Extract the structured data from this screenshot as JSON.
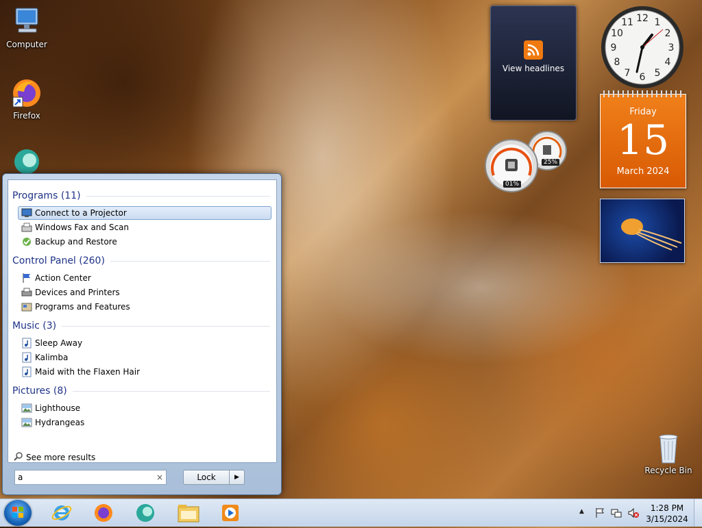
{
  "desktop": {
    "icons": [
      {
        "label": "Computer"
      },
      {
        "label": "Firefox"
      },
      {
        "label": ""
      },
      {
        "label": "Recycle Bin"
      }
    ]
  },
  "gadgets": {
    "feed_label": "View headlines",
    "calendar": {
      "weekday": "Friday",
      "day": "15",
      "month_year": "March 2024"
    },
    "cpu": {
      "cpu_percent": "01%",
      "memory_percent": "25%"
    }
  },
  "start_menu": {
    "groups": [
      {
        "title": "Programs (11)",
        "items": [
          "Connect to a Projector",
          "Windows Fax and Scan",
          "Backup and Restore"
        ]
      },
      {
        "title": "Control Panel (260)",
        "items": [
          "Action Center",
          "Devices and Printers",
          "Programs and Features"
        ]
      },
      {
        "title": "Music (3)",
        "items": [
          "Sleep Away",
          "Kalimba",
          "Maid with the Flaxen Hair"
        ]
      },
      {
        "title": "Pictures (8)",
        "items": [
          "Lighthouse",
          "Hydrangeas"
        ]
      }
    ],
    "see_more": "See more results",
    "search_value": "a",
    "clear_glyph": "×",
    "lock_label": "Lock",
    "lock_arrow": "▶"
  },
  "taskbar": {
    "time": "1:28 PM",
    "date": "3/15/2024"
  },
  "colors": {
    "accent": "#1e3287",
    "calendar": "#e8700e"
  }
}
